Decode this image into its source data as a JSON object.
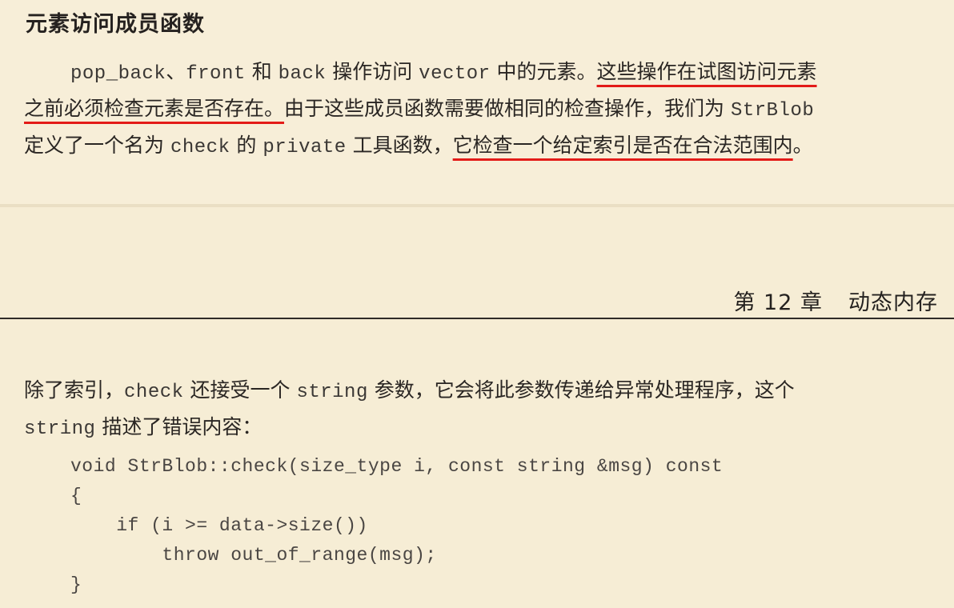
{
  "section": {
    "title": "元素访问成员函数"
  },
  "para1": {
    "s1": "pop_back",
    "s2": "、",
    "s3": "front",
    "s4": " 和 ",
    "s5": "back",
    "s6": " 操作访问 ",
    "s7": "vector",
    "s8": " 中的元素。",
    "s9": "这些操作在试图访问元素",
    "s10": "之前必须检查元素是否存在。",
    "s11": "由于这些成员函数需要做相同的检查操作，我们为 ",
    "s12": "StrBlob",
    "s13": "定义了一个名为 ",
    "s14": "check",
    "s15": " 的 ",
    "s16": "private",
    "s17": " 工具函数，",
    "s18": "它检查一个给定索引是否在合法范围内",
    "s19": "。"
  },
  "chapter": {
    "number": "第 12 章",
    "title": "动态内存"
  },
  "para2": {
    "s1": "除了索引，",
    "s2": "check",
    "s3": " 还接受一个 ",
    "s4": "string",
    "s5": " 参数，它会将此参数传递给异常处理程序，这个",
    "s6": "string",
    "s7": " 描述了错误内容："
  },
  "code": {
    "lines": [
      "void StrBlob::check(size_type i, const string &msg) const",
      "{",
      "    if (i >= data->size())",
      "        throw out_of_range(msg);",
      "}"
    ]
  },
  "colors": {
    "page_background": "#f6edd5",
    "underline": "#e31b18",
    "text": "#2a2623"
  }
}
